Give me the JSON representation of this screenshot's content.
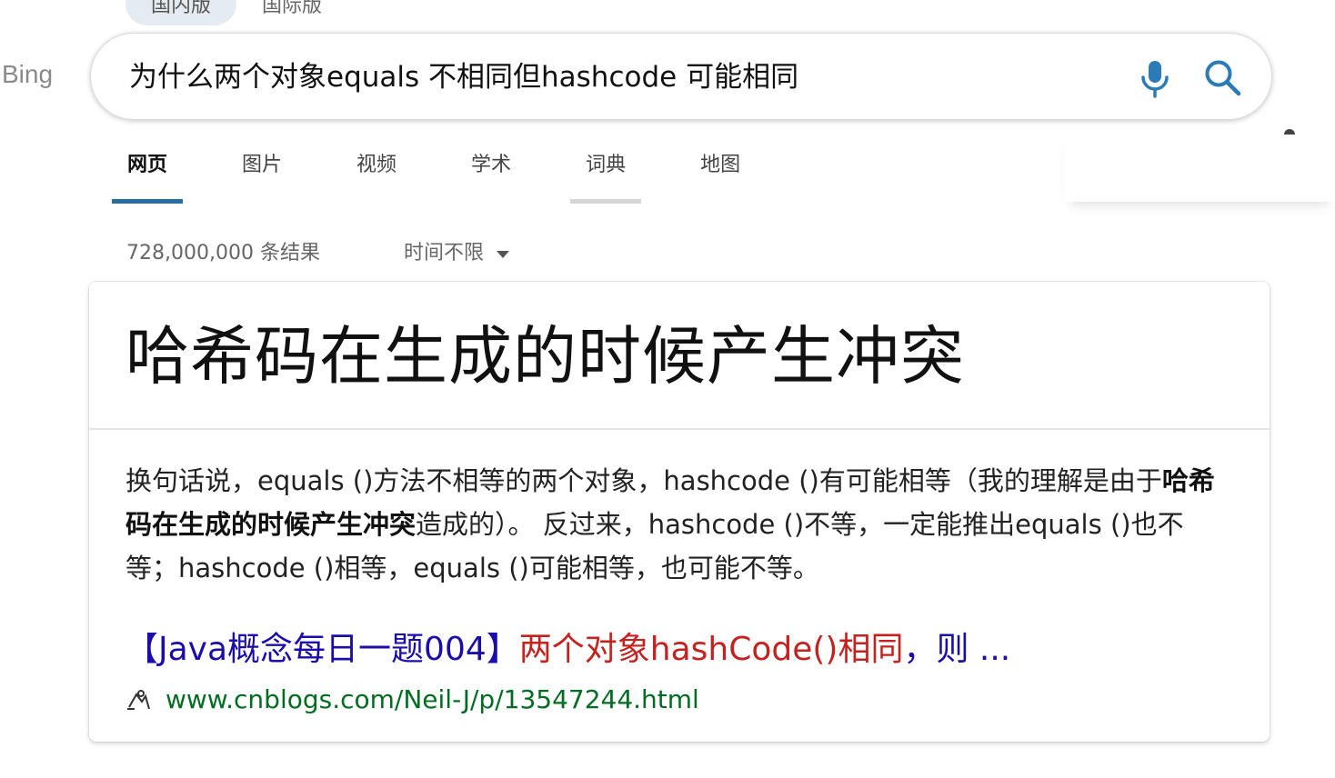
{
  "scope_tabs": [
    {
      "label": "国内版",
      "active": true
    },
    {
      "label": "国际版",
      "active": false
    }
  ],
  "logo": {
    "text": "Bing"
  },
  "search": {
    "query": "为什么两个对象equals 不相同但hashcode 可能相同",
    "mic_icon": "microphone-icon",
    "search_icon": "search-icon"
  },
  "nav_tabs": [
    {
      "label": "网页",
      "active": true
    },
    {
      "label": "图片",
      "active": false
    },
    {
      "label": "视频",
      "active": false
    },
    {
      "label": "学术",
      "active": false
    },
    {
      "label": "词典",
      "active": false,
      "hovered": true
    },
    {
      "label": "地图",
      "active": false
    }
  ],
  "results": {
    "count_text": "728,000,000 条结果",
    "time_filter": "时间不限"
  },
  "answer": {
    "title": "哈希码在生成的时候产生冲突",
    "snippet_before": "换句话说，equals ()方法不相等的两个对象，hashcode ()有可能相等（我的理解是由于",
    "snippet_bold": "哈希码在生成的时候产生冲突",
    "snippet_after": "造成的）。 反过来，hashcode ()不等，一定能推出equals ()也不等；hashcode ()相等，equals ()可能相等，也可能不等。",
    "link_title_part1": "【Java概念每日一题004】",
    "link_title_highlight": "两个对象hashCode()相同",
    "link_title_part2": "，则 ...",
    "url": "www.cnblogs.com/Neil-J/p/13547244.html"
  },
  "colors": {
    "accent": "#2b6d9e",
    "link": "#1a0dab",
    "highlight": "#c5221f",
    "url": "#006d21",
    "icon": "#2b7bb9"
  }
}
